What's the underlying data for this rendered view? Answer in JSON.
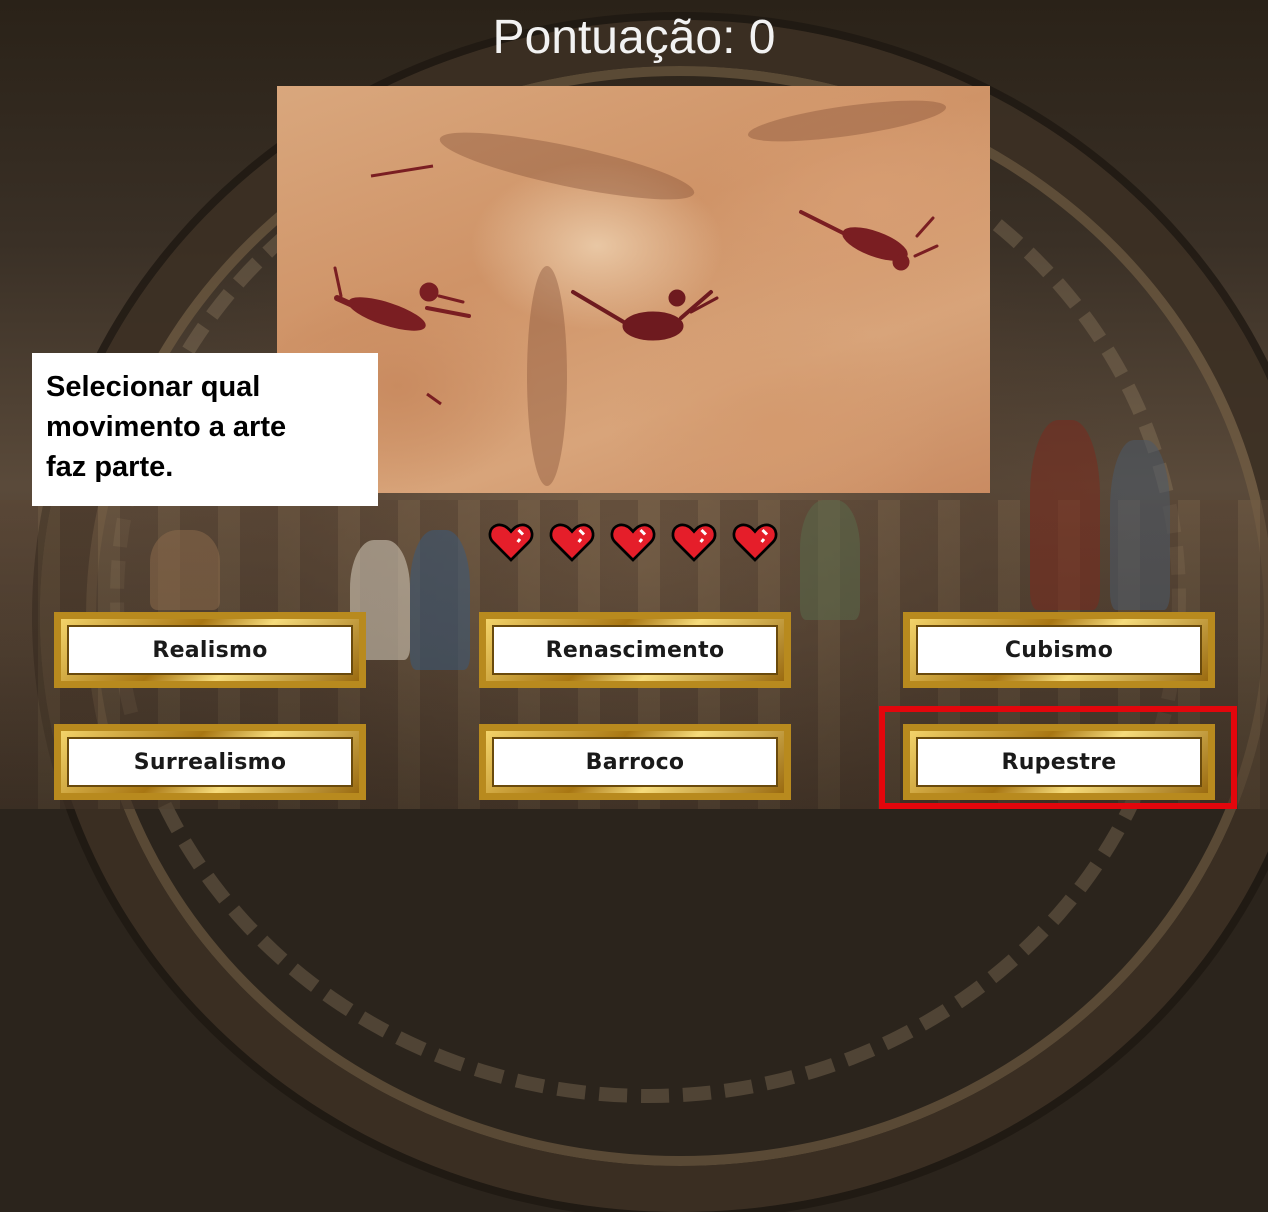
{
  "score": {
    "label": "Pontuação: 0"
  },
  "instruction": {
    "line1": "Selecionar qual",
    "line2": "movimento a arte",
    "line3": "faz parte."
  },
  "lives": {
    "count": 5,
    "icon": "heart-icon",
    "color": "#e51e2a"
  },
  "answers": [
    {
      "label": "Realismo"
    },
    {
      "label": "Renascimento"
    },
    {
      "label": "Cubismo"
    },
    {
      "label": "Surrealismo"
    },
    {
      "label": "Barroco"
    },
    {
      "label": "Rupestre"
    }
  ],
  "colors": {
    "highlight": "#e3060c",
    "frame_gold": "#b88a1e",
    "score_text": "#f2f2f2"
  }
}
